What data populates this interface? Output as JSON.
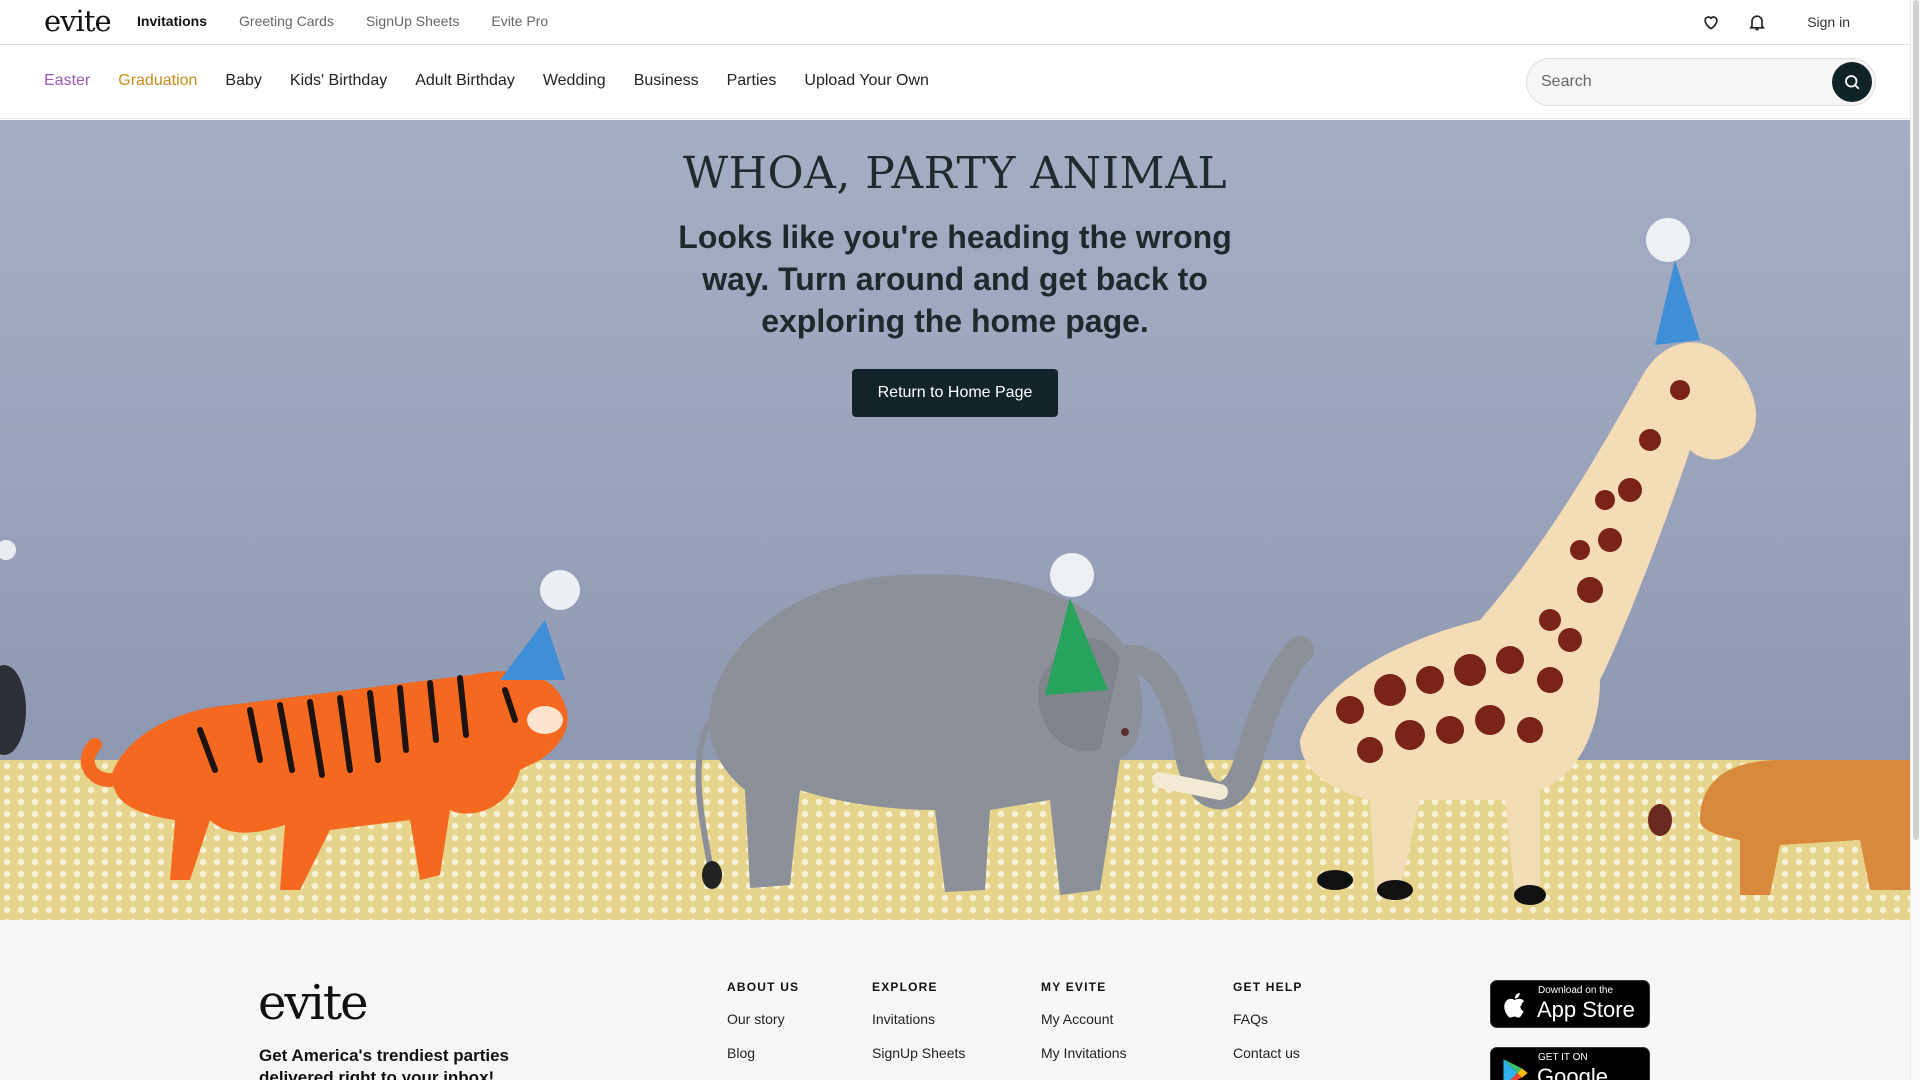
{
  "topbar": {
    "logo": "evite",
    "nav": [
      "Invitations",
      "Greeting Cards",
      "SignUp Sheets",
      "Evite Pro"
    ],
    "signin": "Sign in"
  },
  "categories": [
    "Easter",
    "Graduation",
    "Baby",
    "Kids' Birthday",
    "Adult Birthday",
    "Wedding",
    "Business",
    "Parties",
    "Upload Your Own"
  ],
  "search": {
    "placeholder": "Search"
  },
  "hero": {
    "title": "WHOA, PARTY ANIMAL",
    "subtitle": "Looks like you're heading the wrong way. Turn around and get back to exploring the home page.",
    "button": "Return to Home Page"
  },
  "footer": {
    "logo": "evite",
    "tagline": "Get America's trendiest parties delivered right to your inbox!",
    "columns": [
      {
        "title": "ABOUT US",
        "links": [
          "Our story",
          "Blog"
        ]
      },
      {
        "title": "EXPLORE",
        "links": [
          "Invitations",
          "SignUp Sheets"
        ]
      },
      {
        "title": "MY EVITE",
        "links": [
          "My Account",
          "My Invitations"
        ]
      },
      {
        "title": "GET HELP",
        "links": [
          "FAQs",
          "Contact us"
        ]
      }
    ],
    "app_store": {
      "small": "Download on the",
      "big": "App Store"
    },
    "google_play": {
      "small": "GET IT ON",
      "big": "Google Play"
    }
  },
  "colors": {
    "easter": "#9b59b6",
    "graduation": "#c98a1c",
    "primary_button": "#112428"
  }
}
